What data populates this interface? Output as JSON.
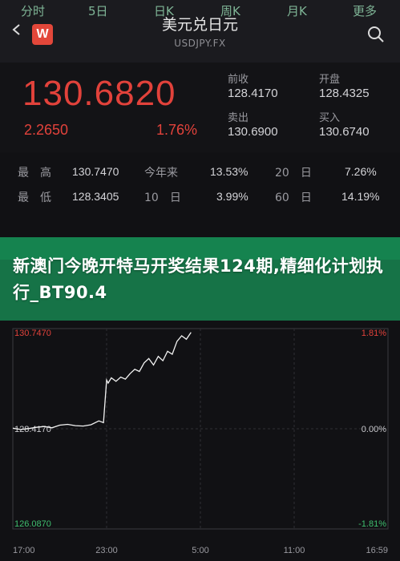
{
  "header": {
    "title": "美元兑日元",
    "subtitle": "USDJPY.FX",
    "logo_letter": "W"
  },
  "quote": {
    "price": "130.6820",
    "change": "2.2650",
    "change_pct": "1.76%",
    "prev_close_label": "前收",
    "prev_close": "128.4170",
    "open_label": "开盘",
    "open": "128.4325",
    "sell_label": "卖出",
    "sell": "130.6900",
    "buy_label": "买入",
    "buy": "130.6740",
    "color_up": "#e2423b"
  },
  "stats": {
    "high_label": "最　高",
    "high": "130.7470",
    "ytd_label": "今年来",
    "ytd": "13.53%",
    "d20_label": "20　日",
    "d20": "7.26%",
    "low_label": "最　低",
    "low": "128.3405",
    "d10_label": "10　日",
    "d10": "3.99%",
    "d60_label": "60　日",
    "d60": "14.19%"
  },
  "tabs": [
    "分时",
    "5日",
    "日K",
    "周K",
    "月K",
    "更多"
  ],
  "banner": {
    "text": "新澳门今晚开特马开奖结果124期,精细化计划执行_BT90.4",
    "color": "#188c54"
  },
  "chart_data": {
    "type": "line",
    "y_left_ticks": [
      "130.7470",
      "128.4170",
      "126.0870"
    ],
    "y_right_ticks": [
      "1.81%",
      "0.00%",
      "-1.81%"
    ],
    "x_ticks": [
      "17:00",
      "23:00",
      "5:00",
      "11:00",
      "16:59"
    ],
    "ylim": [
      126.087,
      130.747
    ],
    "xlim": [
      0,
      24
    ],
    "x": [
      0,
      0.5,
      1,
      1.5,
      2,
      2.5,
      3,
      3.5,
      4,
      4.5,
      5,
      5.5,
      5.8,
      6,
      6.1,
      6.3,
      6.6,
      6.9,
      7.2,
      7.5,
      7.8,
      8.1,
      8.4,
      8.7,
      9.0,
      9.3,
      9.6,
      9.9,
      10.2,
      10.5,
      10.8,
      11.1,
      11.4
    ],
    "y": [
      128.43,
      128.4,
      128.42,
      128.45,
      128.47,
      128.44,
      128.5,
      128.52,
      128.49,
      128.48,
      128.51,
      128.6,
      128.56,
      129.55,
      129.48,
      129.6,
      129.52,
      129.62,
      129.57,
      129.7,
      129.8,
      129.75,
      129.95,
      130.05,
      129.9,
      130.1,
      130.0,
      130.22,
      130.15,
      130.45,
      130.58,
      130.5,
      130.66
    ],
    "line_color": "#f2f2f2",
    "grid": true
  }
}
